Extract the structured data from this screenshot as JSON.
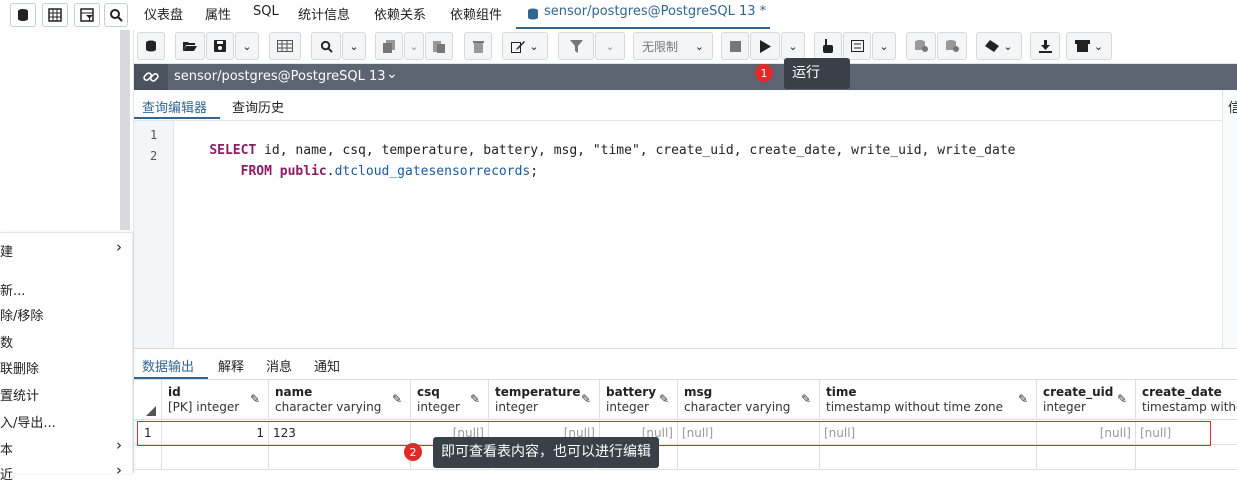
{
  "app": {
    "top_tabs": [
      "仪表盘",
      "属性",
      "SQL",
      "统计信息",
      "依赖关系",
      "依赖组件"
    ],
    "active_tab": "sensor/postgres@PostgreSQL 13 *"
  },
  "left_menu": {
    "items": [
      "建",
      "新...",
      "除/移除",
      "数",
      "联删除",
      "置统计",
      "入/导出...",
      "本",
      "近"
    ]
  },
  "toolbar": {
    "limit_label": "无限制"
  },
  "connection": {
    "label": "sensor/postgres@PostgreSQL 13"
  },
  "run_tooltip": {
    "badge": "1",
    "text": "运行"
  },
  "editor_tabs": [
    "查询编辑器",
    "查询历史"
  ],
  "right_edge_char": "信",
  "sql": {
    "line_numbers": [
      "1",
      "2"
    ],
    "line1": {
      "kw_select": "SELECT",
      "rest": " id, name, csq, temperature, battery, msg, \"time\", create_uid, create_date, write_uid, write_date"
    },
    "line2": {
      "indent": "    ",
      "kw_from": "FROM",
      "space": " ",
      "schema": "public",
      "dot": ".",
      "table": "dtcloud_gatesensorrecords",
      "semi": ";"
    }
  },
  "output_tabs": [
    "数据输出",
    "解释",
    "消息",
    "通知"
  ],
  "grid": {
    "columns": [
      {
        "name": "id",
        "type": "[PK] integer"
      },
      {
        "name": "name",
        "type": "character varying"
      },
      {
        "name": "csq",
        "type": "integer"
      },
      {
        "name": "temperature",
        "type": "integer"
      },
      {
        "name": "battery",
        "type": "integer"
      },
      {
        "name": "msg",
        "type": "character varying"
      },
      {
        "name": "time",
        "type": "timestamp without time zone"
      },
      {
        "name": "create_uid",
        "type": "integer"
      },
      {
        "name": "create_date",
        "type": "timestamp without time zone"
      }
    ],
    "row": {
      "index": "1",
      "id": "1",
      "name": "123",
      "csq": "[null]",
      "temperature": "[null]",
      "battery": "[null]",
      "msg": "[null]",
      "time": "[null]",
      "create_uid": "[null]",
      "create_date": "[null]"
    }
  },
  "edit_tooltip": {
    "badge": "2",
    "text": "即可查看表内容，也可以进行编辑"
  },
  "icons": {
    "accent": "#326690",
    "header_bar": "#5b6470",
    "badge_color": "#e02a2a"
  }
}
